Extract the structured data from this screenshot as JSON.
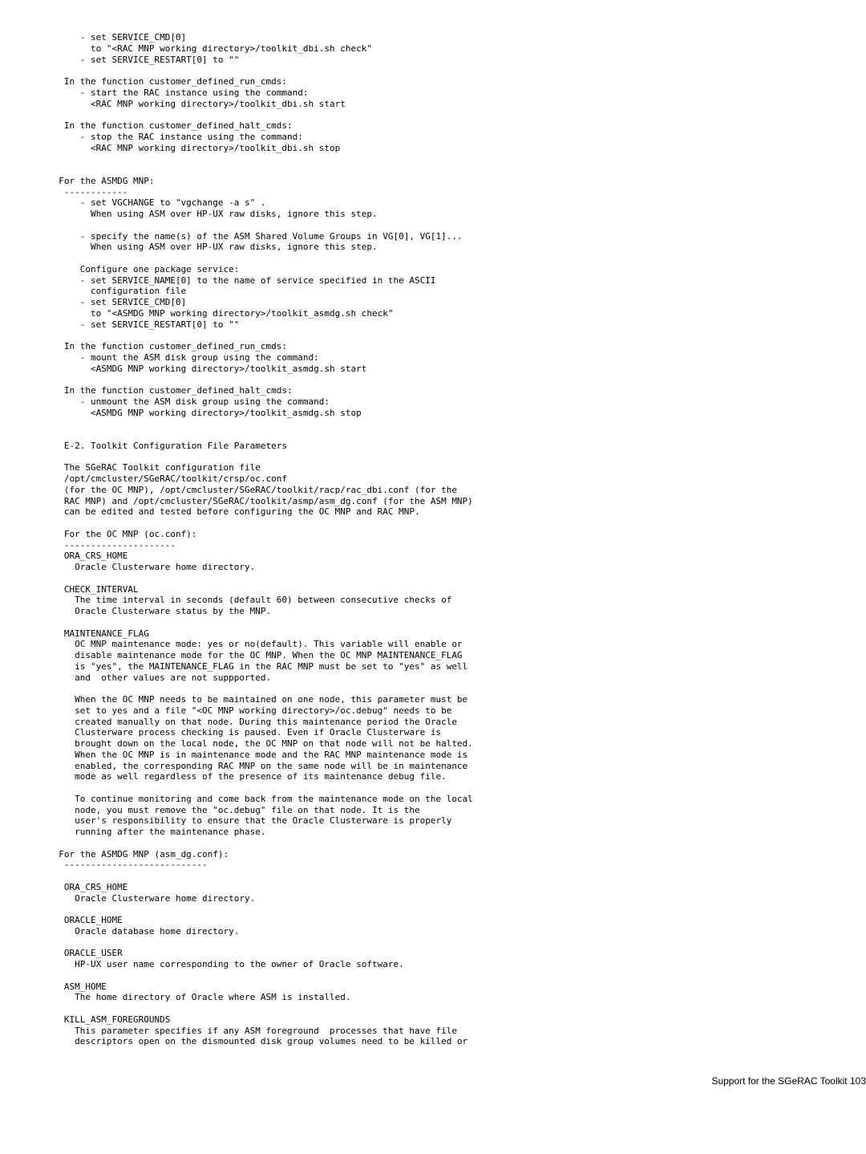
{
  "body_text": "      - set SERVICE_CMD[0]\n        to \"<RAC MNP working directory>/toolkit_dbi.sh check\"\n      - set SERVICE_RESTART[0] to \"\"\n\n   In the function customer_defined_run_cmds:\n      - start the RAC instance using the command:\n        <RAC MNP working directory>/toolkit_dbi.sh start\n\n   In the function customer_defined_halt_cmds:\n      - stop the RAC instance using the command:\n        <RAC MNP working directory>/toolkit_dbi.sh stop\n\n\n  For the ASMDG MNP:\n   ------------\n      - set VGCHANGE to \"vgchange -a s\" .\n        When using ASM over HP-UX raw disks, ignore this step.\n\n      - specify the name(s) of the ASM Shared Volume Groups in VG[0], VG[1]...\n        When using ASM over HP-UX raw disks, ignore this step.\n\n      Configure one package service:\n      - set SERVICE_NAME[0] to the name of service specified in the ASCII\n        configuration file\n      - set SERVICE_CMD[0]\n        to \"<ASMDG MNP working directory>/toolkit_asmdg.sh check\"\n      - set SERVICE_RESTART[0] to \"\"\n\n   In the function customer_defined_run_cmds:\n      - mount the ASM disk group using the command:\n        <ASMDG MNP working directory>/toolkit_asmdg.sh start\n\n   In the function customer_defined_halt_cmds:\n      - unmount the ASM disk group using the command:\n        <ASMDG MNP working directory>/toolkit_asmdg.sh stop\n\n\n   E-2. Toolkit Configuration File Parameters\n\n   The SGeRAC Toolkit configuration file\n   /opt/cmcluster/SGeRAC/toolkit/crsp/oc.conf\n   (for the OC MNP), /opt/cmcluster/SGeRAC/toolkit/racp/rac_dbi.conf (for the\n   RAC MNP) and /opt/cmcluster/SGeRAC/toolkit/asmp/asm_dg.conf (for the ASM MNP)\n   can be edited and tested before configuring the OC MNP and RAC MNP.\n\n   For the OC MNP (oc.conf):\n   ---------------------\n   ORA_CRS_HOME\n     Oracle Clusterware home directory.\n\n   CHECK_INTERVAL\n     The time interval in seconds (default 60) between consecutive checks of\n     Oracle Clusterware status by the MNP.\n\n   MAINTENANCE_FLAG\n     OC MNP maintenance mode: yes or no(default). This variable will enable or\n     disable maintenance mode for the OC MNP. When the OC MNP MAINTENANCE_FLAG\n     is \"yes\", the MAINTENANCE_FLAG in the RAC MNP must be set to \"yes\" as well\n     and  other values are not suppported.\n\n     When the OC MNP needs to be maintained on one node, this parameter must be\n     set to yes and a file \"<OC MNP working directory>/oc.debug\" needs to be\n     created manually on that node. During this maintenance period the Oracle\n     Clusterware process checking is paused. Even if Oracle Clusterware is\n     brought down on the local node, the OC MNP on that node will not be halted.\n     When the OC MNP is in maintenance mode and the RAC MNP maintenance mode is\n     enabled, the corresponding RAC MNP on the same node will be in maintenance\n     mode as well regardless of the presence of its maintenance debug file.\n\n     To continue monitoring and come back from the maintenance mode on the local\n     node, you must remove the \"oc.debug\" file on that node. It is the\n     user's responsibility to ensure that the Oracle Clusterware is properly\n     running after the maintenance phase.\n\n  For the ASMDG MNP (asm_dg.conf):\n   ---------------------------\n\n   ORA_CRS_HOME\n     Oracle Clusterware home directory.\n\n   ORACLE_HOME\n     Oracle database home directory.\n\n   ORACLE_USER\n     HP-UX user name corresponding to the owner of Oracle software.\n\n   ASM_HOME\n     The home directory of Oracle where ASM is installed.\n\n   KILL_ASM_FOREGROUNDS\n     This parameter specifies if any ASM foreground  processes that have file\n     descriptors open on the dismounted disk group volumes need to be killed or",
  "footer_text": "Support for the SGeRAC Toolkit   103"
}
